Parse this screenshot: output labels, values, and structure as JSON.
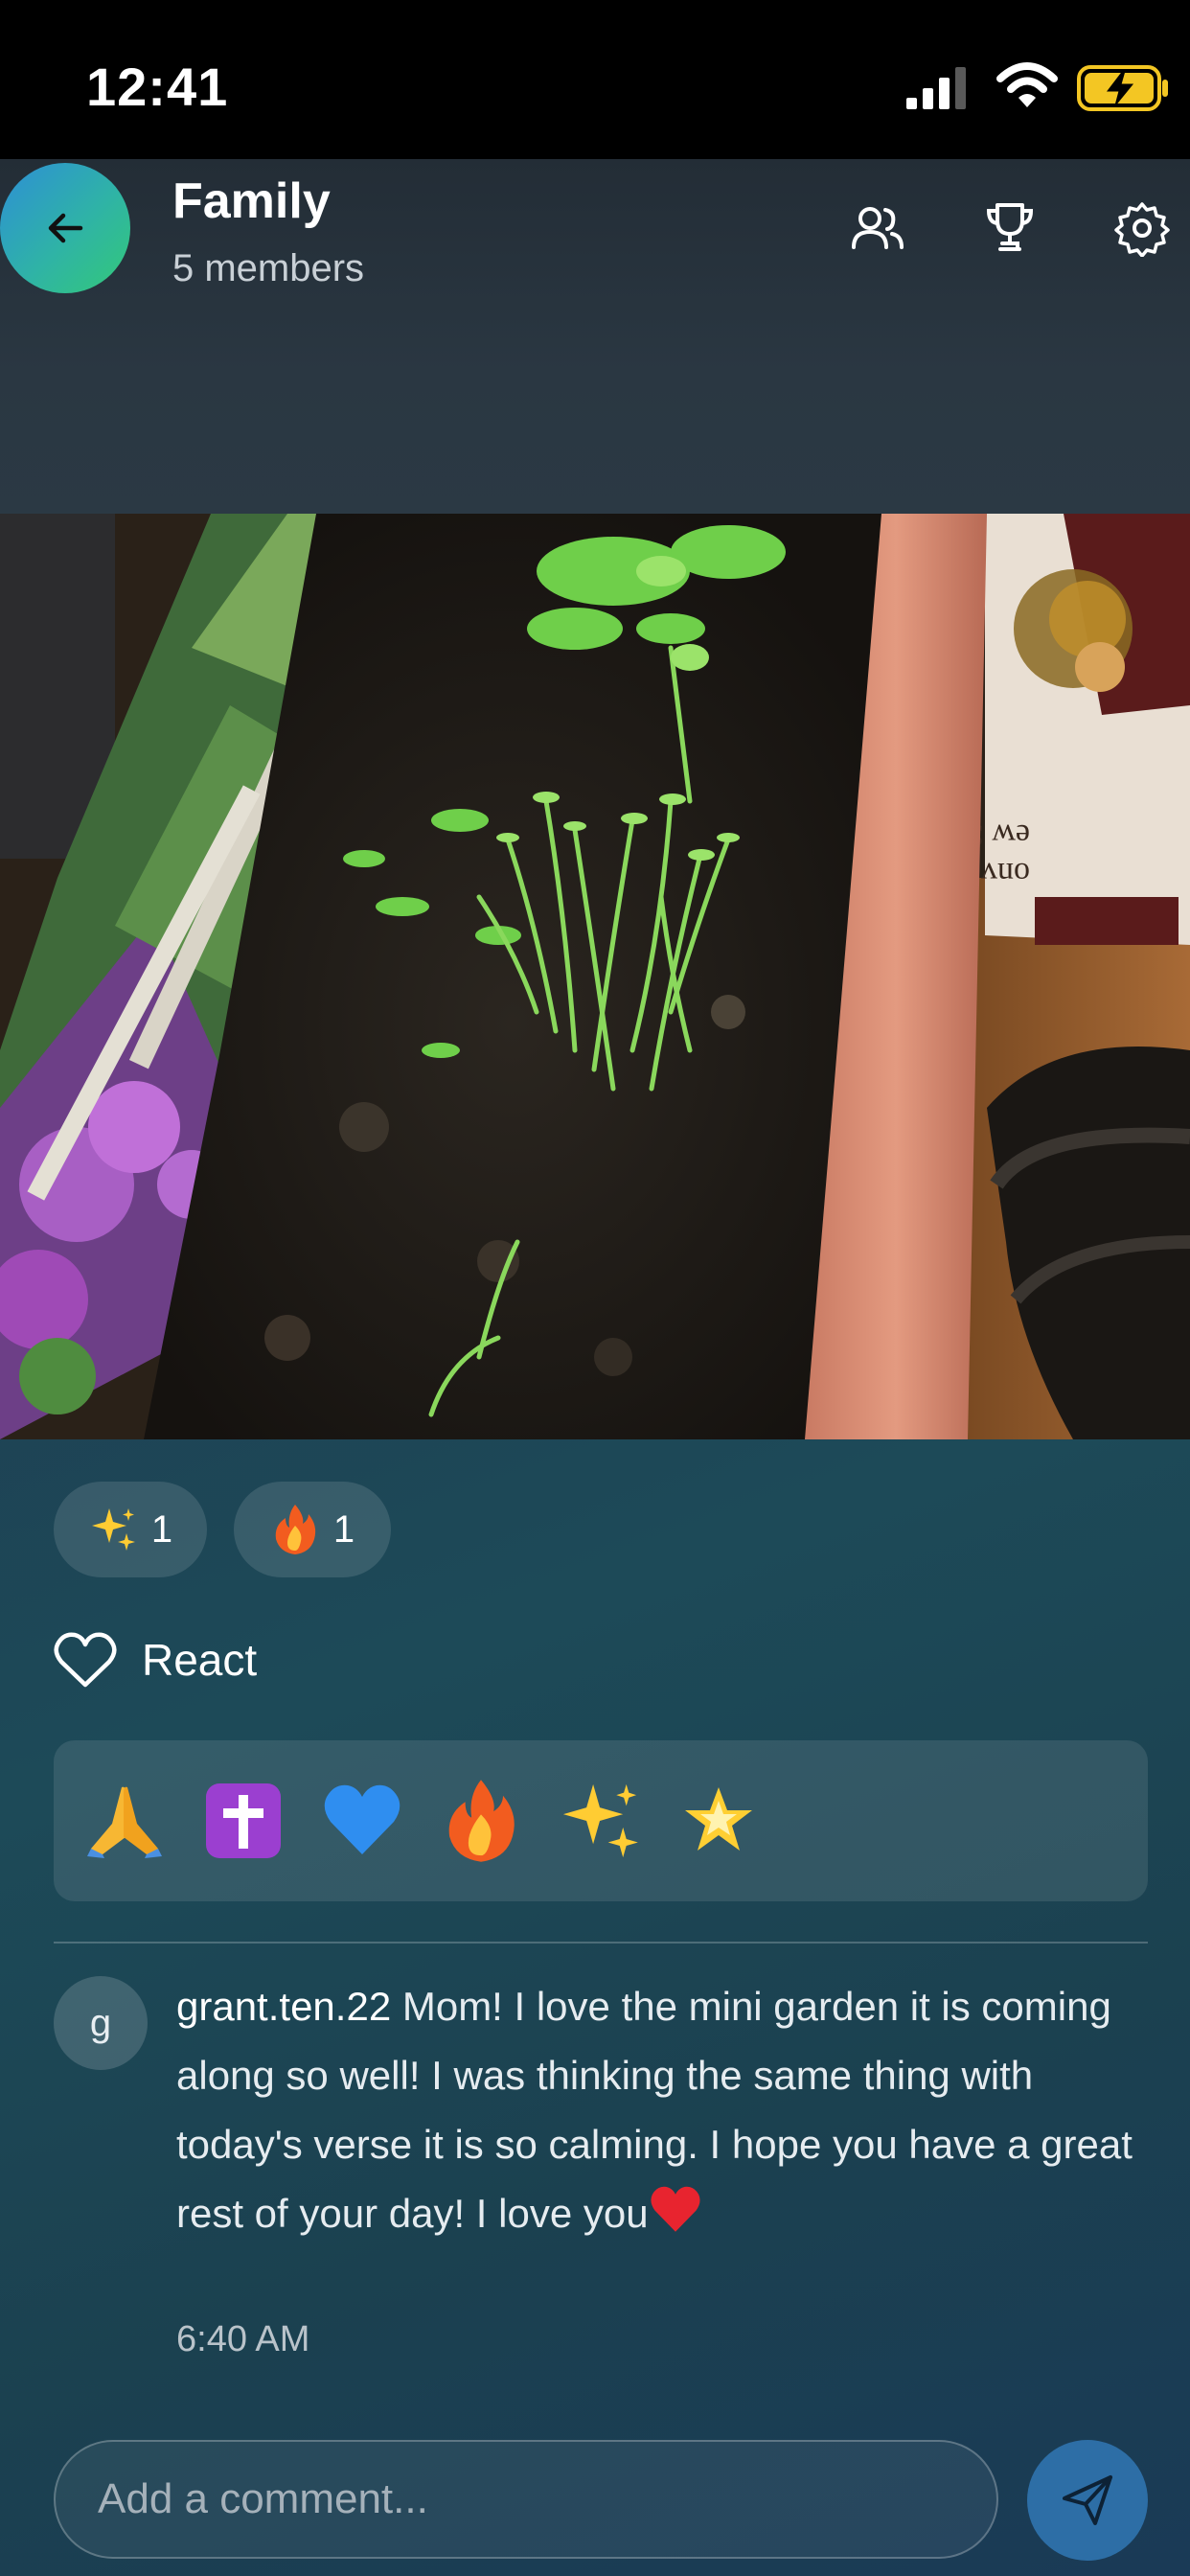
{
  "status_bar": {
    "time": "12:41",
    "icons": [
      "signal-icon",
      "wifi-icon",
      "battery-charging-icon"
    ]
  },
  "header": {
    "title": "Family",
    "subtitle": "5 members",
    "icons": [
      "back-arrow-icon",
      "members-icon",
      "trophy-icon",
      "gear-icon"
    ]
  },
  "post": {
    "image_description_icon": "garden-photo"
  },
  "reactions": {
    "chips": [
      {
        "emoji": "sparkles",
        "count": "1"
      },
      {
        "emoji": "fire",
        "count": "1"
      }
    ],
    "react_label": "React",
    "picker_emojis": [
      "folded-hands",
      "latin-cross",
      "blue-heart",
      "fire",
      "sparkles",
      "glowing-star"
    ]
  },
  "comment": {
    "avatar_letter": "g",
    "username": "grant.ten.22",
    "text": "Mom! I love the mini garden it is coming along so well! I was thinking the same thing with today's verse it is so calming. I hope you have a great rest of your day! I love you",
    "trailing_emoji": "red-heart",
    "time": "6:40 AM"
  },
  "composer": {
    "placeholder": "Add a comment...",
    "value": ""
  },
  "colors": {
    "accent": "#2d6ea6",
    "status_bar_bg": "#000000",
    "header_bg": "#2a3742",
    "page_bg": "#1e3d52"
  }
}
